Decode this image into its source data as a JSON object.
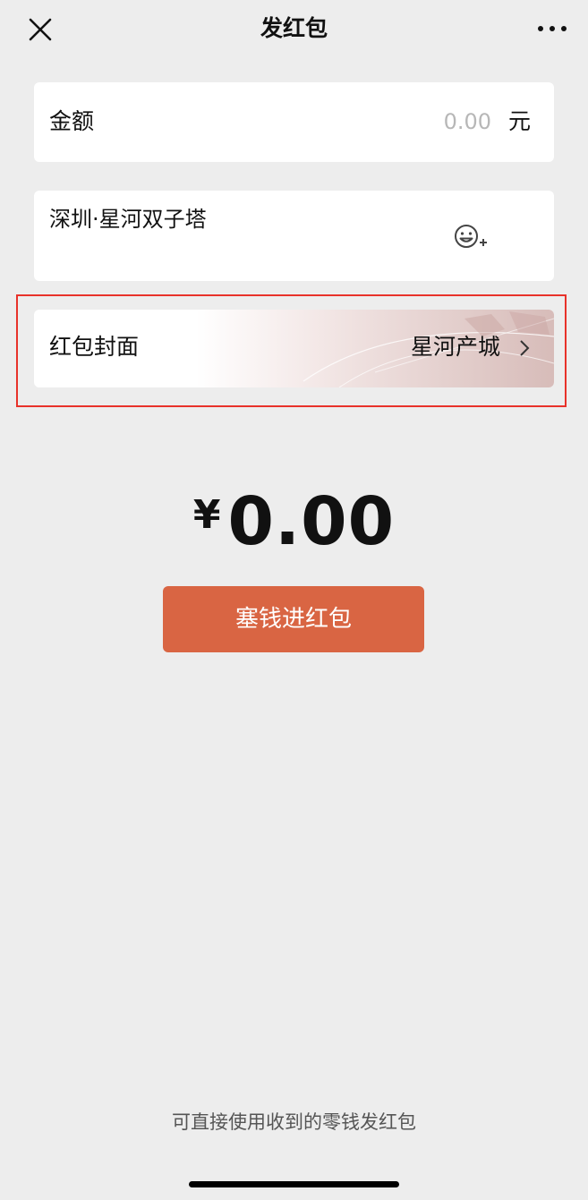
{
  "header": {
    "title": "发红包",
    "close_icon": "close-icon",
    "more_icon": "more-dots-icon"
  },
  "amount": {
    "label": "金额",
    "placeholder": "0.00",
    "unit": "元"
  },
  "message": {
    "value": "深圳·星河双子塔",
    "emoji_icon": "emoji-plus-icon"
  },
  "cover": {
    "label": "红包封面",
    "value": "星河产城",
    "chevron_icon": "chevron-right-icon"
  },
  "total": {
    "currency": "¥",
    "value": "0.00"
  },
  "submit": {
    "label": "塞钱进红包"
  },
  "footer": {
    "hint": "可直接使用收到的零钱发红包"
  },
  "colors": {
    "background": "#ededed",
    "card": "#ffffff",
    "button": "#d96543",
    "highlight_box": "#e8322a"
  }
}
